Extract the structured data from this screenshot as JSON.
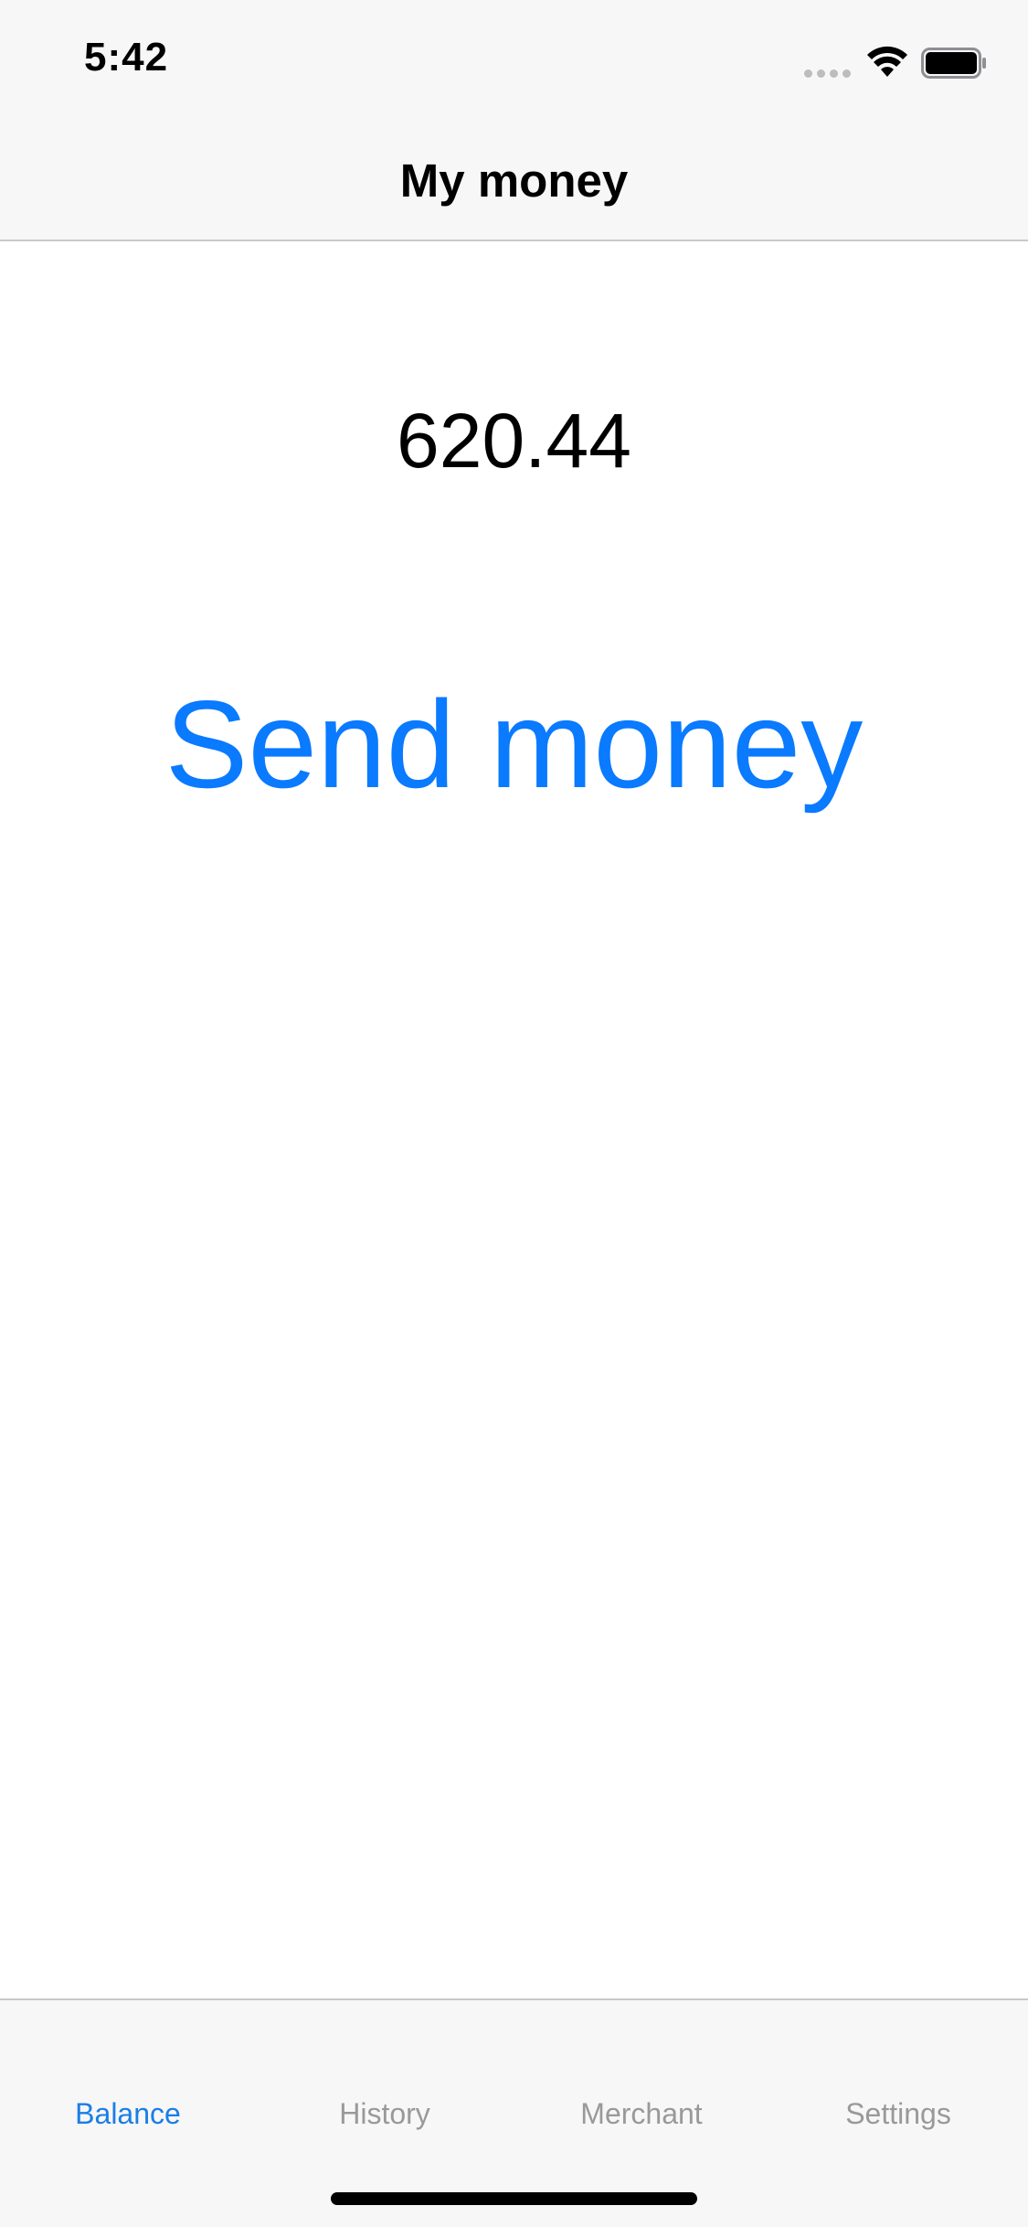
{
  "status_bar": {
    "time": "5:42",
    "signal_icon": "cellular-signal-icon",
    "wifi_icon": "wifi-icon",
    "battery_icon": "battery-icon"
  },
  "nav": {
    "title": "My money"
  },
  "main": {
    "balance": "620.44",
    "send_label": "Send money"
  },
  "tabs": [
    {
      "label": "Balance",
      "active": true
    },
    {
      "label": "History",
      "active": false
    },
    {
      "label": "Merchant",
      "active": false
    },
    {
      "label": "Settings",
      "active": false
    }
  ],
  "colors": {
    "accent": "#0a7aff",
    "tab_active": "#1a7ee6",
    "tab_inactive": "#999999",
    "bar_background": "#f7f7f7"
  }
}
